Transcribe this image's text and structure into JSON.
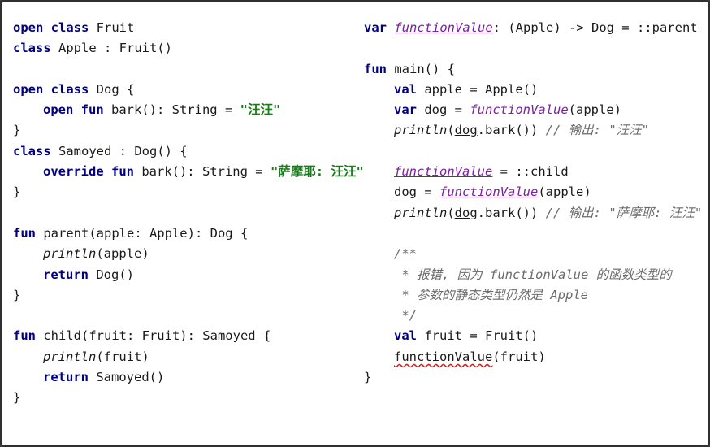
{
  "left_lines": [
    [
      {
        "t": "open class",
        "c": "kw"
      },
      {
        "t": " Fruit",
        "c": ""
      }
    ],
    [
      {
        "t": "class",
        "c": "kw"
      },
      {
        "t": " Apple : Fruit()",
        "c": ""
      }
    ],
    [],
    [
      {
        "t": "open class",
        "c": "kw"
      },
      {
        "t": " Dog {",
        "c": ""
      }
    ],
    [
      {
        "indent": 1
      },
      {
        "t": "open fun",
        "c": "kw"
      },
      {
        "t": " bark(): String = ",
        "c": ""
      },
      {
        "t": "\"汪汪\"",
        "c": "str"
      }
    ],
    [
      {
        "t": "}",
        "c": ""
      }
    ],
    [
      {
        "t": "class",
        "c": "kw"
      },
      {
        "t": " Samoyed : Dog() {",
        "c": ""
      }
    ],
    [
      {
        "indent": 1
      },
      {
        "t": "override fun",
        "c": "kw"
      },
      {
        "t": " bark(): String = ",
        "c": ""
      },
      {
        "t": "\"萨摩耶: 汪汪\"",
        "c": "str"
      }
    ],
    [
      {
        "t": "}",
        "c": ""
      }
    ],
    [],
    [
      {
        "t": "fun",
        "c": "kw"
      },
      {
        "t": " parent(apple: Apple): Dog {",
        "c": ""
      }
    ],
    [
      {
        "indent": 1
      },
      {
        "t": "println",
        "c": "it"
      },
      {
        "t": "(apple)",
        "c": ""
      }
    ],
    [
      {
        "indent": 1
      },
      {
        "t": "return",
        "c": "kw"
      },
      {
        "t": " Dog()",
        "c": ""
      }
    ],
    [
      {
        "t": "}",
        "c": ""
      }
    ],
    [],
    [
      {
        "t": "fun",
        "c": "kw"
      },
      {
        "t": " child(fruit: Fruit): Samoyed {",
        "c": ""
      }
    ],
    [
      {
        "indent": 1
      },
      {
        "t": "println",
        "c": "it"
      },
      {
        "t": "(fruit)",
        "c": ""
      }
    ],
    [
      {
        "indent": 1
      },
      {
        "t": "return",
        "c": "kw"
      },
      {
        "t": " Samoyed()",
        "c": ""
      }
    ],
    [
      {
        "t": "}",
        "c": ""
      }
    ]
  ],
  "right_lines": [
    [
      {
        "t": "var",
        "c": "kw"
      },
      {
        "t": " ",
        "c": ""
      },
      {
        "t": "functionValue",
        "c": "fnref"
      },
      {
        "t": ": (Apple) -> Dog = ::parent",
        "c": ""
      }
    ],
    [],
    [
      {
        "t": "fun",
        "c": "kw"
      },
      {
        "t": " main() {",
        "c": ""
      }
    ],
    [
      {
        "indent": 1
      },
      {
        "t": "val",
        "c": "kw"
      },
      {
        "t": " apple = Apple()",
        "c": ""
      }
    ],
    [
      {
        "indent": 1
      },
      {
        "t": "var",
        "c": "kw"
      },
      {
        "t": " ",
        "c": ""
      },
      {
        "t": "dog",
        "c": "ul"
      },
      {
        "t": " = ",
        "c": ""
      },
      {
        "t": "functionValue",
        "c": "fnref"
      },
      {
        "t": "(apple)",
        "c": ""
      }
    ],
    [
      {
        "indent": 1
      },
      {
        "t": "println",
        "c": "it"
      },
      {
        "t": "(",
        "c": ""
      },
      {
        "t": "dog",
        "c": "ul"
      },
      {
        "t": ".bark()) ",
        "c": ""
      },
      {
        "t": "// 输出: \"汪汪\"",
        "c": "comment"
      }
    ],
    [],
    [
      {
        "indent": 1
      },
      {
        "t": "functionValue",
        "c": "fnref"
      },
      {
        "t": " = ::child",
        "c": ""
      }
    ],
    [
      {
        "indent": 1
      },
      {
        "t": "dog",
        "c": "ul"
      },
      {
        "t": " = ",
        "c": ""
      },
      {
        "t": "functionValue",
        "c": "fnref"
      },
      {
        "t": "(apple)",
        "c": ""
      }
    ],
    [
      {
        "indent": 1
      },
      {
        "t": "println",
        "c": "it"
      },
      {
        "t": "(",
        "c": ""
      },
      {
        "t": "dog",
        "c": "ul"
      },
      {
        "t": ".bark()) ",
        "c": ""
      },
      {
        "t": "// 输出: \"萨摩耶: 汪汪\"",
        "c": "comment"
      }
    ],
    [],
    [
      {
        "indent": 1
      },
      {
        "t": "/**",
        "c": "comment"
      }
    ],
    [
      {
        "indent": 1
      },
      {
        "t": " * 报错, 因为 functionValue 的函数类型的",
        "c": "comment"
      }
    ],
    [
      {
        "indent": 1
      },
      {
        "t": " * 参数的静态类型仍然是 Apple",
        "c": "comment"
      }
    ],
    [
      {
        "indent": 1
      },
      {
        "t": " */",
        "c": "comment"
      }
    ],
    [
      {
        "indent": 1
      },
      {
        "t": "val",
        "c": "kw"
      },
      {
        "t": " fruit = Fruit()",
        "c": ""
      }
    ],
    [
      {
        "indent": 1
      },
      {
        "t": "functionValue",
        "c": "err"
      },
      {
        "t": "(fruit)",
        "c": ""
      }
    ],
    [
      {
        "t": "}",
        "c": ""
      }
    ]
  ]
}
